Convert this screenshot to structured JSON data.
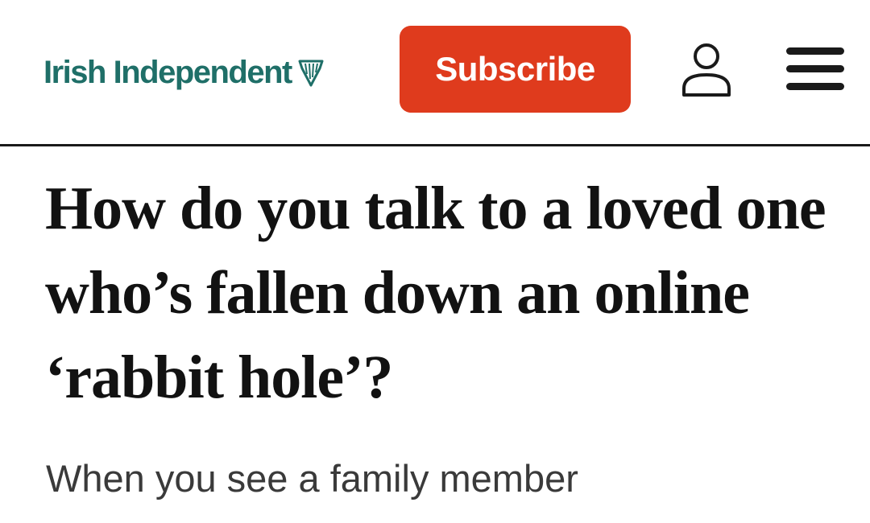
{
  "header": {
    "logo_text": "Irish Independent",
    "logo_icon": "harp-icon",
    "brand_color": "#1f6f68",
    "subscribe_label": "Subscribe",
    "subscribe_color": "#df3b1d",
    "account_icon": "user-icon",
    "menu_icon": "hamburger-menu-icon"
  },
  "article": {
    "headline": "How do you talk to a loved one who’s fallen down an online ‘rabbit hole’?",
    "standfirst": "When you see a family member"
  }
}
